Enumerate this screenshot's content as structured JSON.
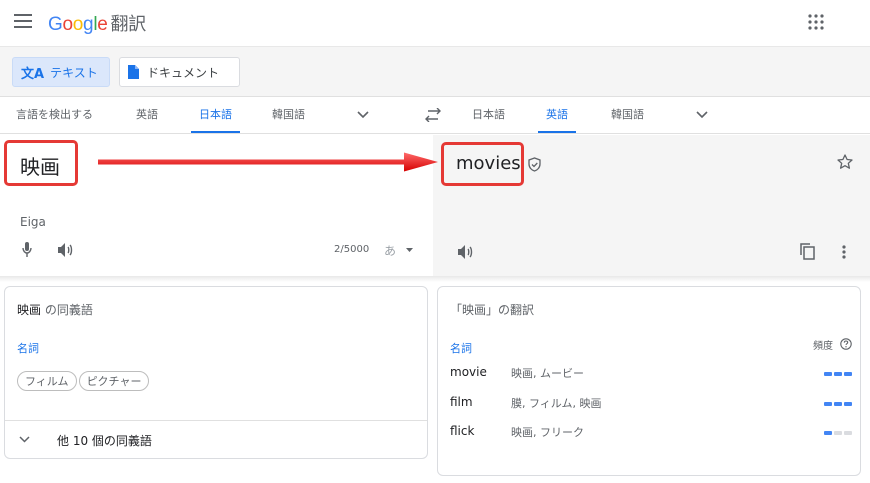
{
  "header": {
    "logo": {
      "g1": "G",
      "g2": "o",
      "g3": "o",
      "g4": "g",
      "g5": "l",
      "g6": "e"
    },
    "product": "翻訳"
  },
  "modes": {
    "text_label": "テキスト",
    "document_label": "ドキュメント"
  },
  "source_langs": [
    "言語を検出する",
    "英語",
    "日本語",
    "韓国語"
  ],
  "target_langs": [
    "日本語",
    "英語",
    "韓国語"
  ],
  "source": {
    "text": "映画",
    "romanization": "Eiga",
    "char_count": "2/5000",
    "input_tool": "あ"
  },
  "target": {
    "text": "movies"
  },
  "synonyms": {
    "heading_word": "映画",
    "heading_suffix": " の同義語",
    "pos": "名詞",
    "chips": [
      "フィルム",
      "ピクチャー"
    ],
    "more": "他 10 個の同義語"
  },
  "translations": {
    "heading": "「映画」の翻訳",
    "pos": "名詞",
    "freq_label": "頻度",
    "rows": [
      {
        "word": "movie",
        "back": "映画, ムービー",
        "freq": 3
      },
      {
        "word": "film",
        "back": "膜, フィルム, 映画",
        "freq": 3
      },
      {
        "word": "flick",
        "back": "映画, フリーク",
        "freq": 1
      }
    ]
  },
  "colors": {
    "accent": "#1a73e8",
    "annotation_red": "#e53935"
  }
}
